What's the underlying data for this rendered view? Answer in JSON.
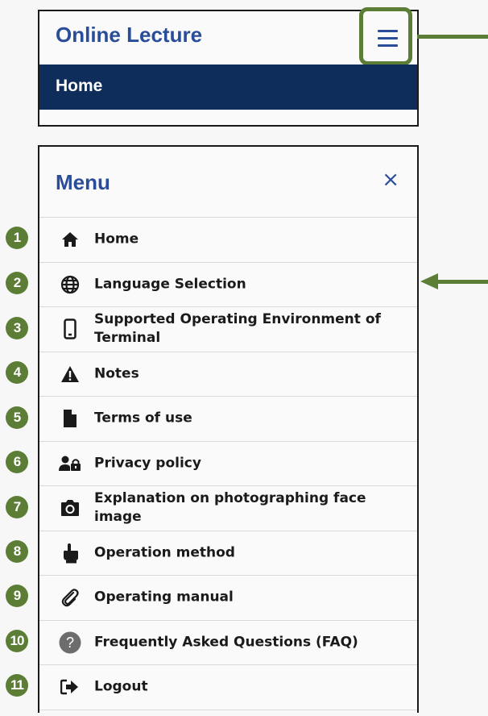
{
  "header": {
    "title": "Online Lecture",
    "breadcrumb": "Home"
  },
  "menu": {
    "title": "Menu",
    "close_symbol": "×",
    "items": [
      {
        "number": "1",
        "label": "Home",
        "icon": "home-icon"
      },
      {
        "number": "2",
        "label": "Language Selection",
        "icon": "globe-icon"
      },
      {
        "number": "3",
        "label": "Supported Operating Environment of Terminal",
        "icon": "smartphone-icon"
      },
      {
        "number": "4",
        "label": "Notes",
        "icon": "warning-icon"
      },
      {
        "number": "5",
        "label": "Terms of use",
        "icon": "document-icon"
      },
      {
        "number": "6",
        "label": "Privacy policy",
        "icon": "user-lock-icon"
      },
      {
        "number": "7",
        "label": "Explanation on photographing face image",
        "icon": "camera-icon"
      },
      {
        "number": "8",
        "label": "Operation method",
        "icon": "pointing-hand-icon"
      },
      {
        "number": "9",
        "label": "Operating manual",
        "icon": "paperclip-icon"
      },
      {
        "number": "10",
        "label": "Frequently Asked Questions (FAQ)",
        "icon": "question-icon"
      },
      {
        "number": "11",
        "label": "Logout",
        "icon": "logout-icon"
      }
    ]
  },
  "colors": {
    "brand_blue": "#2a4d9a",
    "nav_dark": "#0e2d5a",
    "annotation_green": "#5b7d36"
  }
}
